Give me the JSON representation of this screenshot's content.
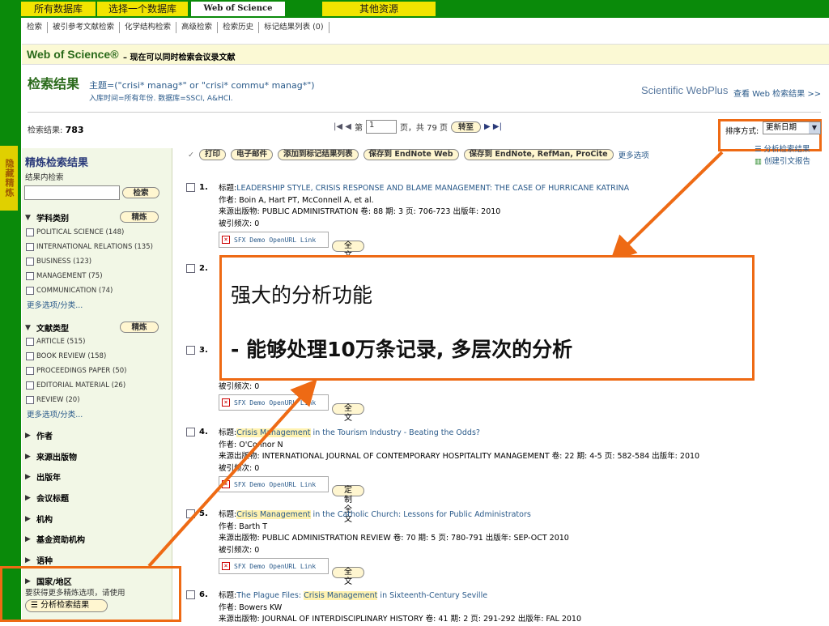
{
  "top_tabs": [
    {
      "label": "所有数据库"
    },
    {
      "label": "选择一个数据库"
    },
    {
      "label": "Web of Science"
    },
    {
      "label": "其他资源"
    }
  ],
  "sub_nav": [
    "检索",
    "被引参考文献检索",
    "化学结构检索",
    "高级检索",
    "检索历史",
    "标记结果列表 (0)"
  ],
  "side_tab": "隐藏精炼",
  "title_bar": {
    "brand": "Web of Science®",
    "subtitle": "– 现在可以同时检索会议录文献"
  },
  "search_results": {
    "heading": "检索结果",
    "query": "主题=(\"crisi* manag*\" or \"crisi* commu* manag*\")",
    "sub": "入库时间=所有年份. 数据库=SSCI, A&HCI.",
    "webplus_logo": "Scientific WebPlus",
    "webplus_link": "查看 Web 检索结果 >>",
    "count_label": "检索结果:",
    "count": "783"
  },
  "pager": {
    "first_prev": "|◀ ◀",
    "page_label": "第",
    "page_value": "1",
    "of_label": "页，共 79 页",
    "go_button": "转至",
    "next_last": "▶ ▶|"
  },
  "sort": {
    "label": "排序方式:",
    "value": "更新日期"
  },
  "right_links": {
    "analyze": "分析检索结果",
    "citation_report": "创建引文报告"
  },
  "refine": {
    "title": "精炼检索结果",
    "within_label": "结果内检索",
    "search_button": "检索",
    "subject": {
      "label": "学科类别",
      "button": "精炼",
      "items": [
        "POLITICAL SCIENCE (148)",
        "INTERNATIONAL RELATIONS (135)",
        "BUSINESS (123)",
        "MANAGEMENT (75)",
        "COMMUNICATION (74)"
      ],
      "more": "更多选项/分类..."
    },
    "doctype": {
      "label": "文献类型",
      "button": "精炼",
      "items": [
        "ARTICLE (515)",
        "BOOK REVIEW (158)",
        "PROCEEDINGS PAPER (50)",
        "EDITORIAL MATERIAL (26)",
        "REVIEW (20)"
      ],
      "more": "更多选项/分类..."
    },
    "collapsed": [
      "作者",
      "来源出版物",
      "出版年",
      "会议标题",
      "机构",
      "基金资助机构",
      "语种",
      "国家/地区"
    ],
    "note": "要获得更多精炼选项，请使用",
    "analyze_button": "分析检索结果"
  },
  "toolbar": {
    "buttons": [
      "打印",
      "电子邮件",
      "添加到标记结果列表"
    ],
    "save_endnote_web": "保存到 EndNote Web",
    "save_endnote": "保存到 EndNote, RefMan, ProCite",
    "more": "更多选项"
  },
  "records": [
    {
      "num": "1.",
      "title_label": "标题:",
      "title": "LEADERSHIP STYLE, CRISIS RESPONSE AND BLAME MANAGEMENT: THE CASE OF HURRICANE KATRINA",
      "author": "作者: Boin A, Hart PT, McConnell A, et al.",
      "source": "来源出版物: PUBLIC ADMINISTRATION  卷: 88  期: 3  页: 706-723  出版年: 2010",
      "cited": "被引频次: 0",
      "sfx": "SFX Demo OpenURL Link",
      "fulltext": "全文"
    },
    {
      "num": "2."
    },
    {
      "num": "3.",
      "cited": "被引频次: 0",
      "sfx": "SFX Demo OpenURL Link",
      "fulltext": "全文"
    },
    {
      "num": "4.",
      "title_label": "标题:",
      "title_hl": "Crisis Management",
      "title": " in the Tourism Industry - Beating the Odds?",
      "author": "作者: O'Connor N",
      "source": "来源出版物: INTERNATIONAL JOURNAL OF CONTEMPORARY HOSPITALITY MANAGEMENT  卷: 22  期: 4-5  页: 582-584  出版年: 2010",
      "cited": "被引频次: 0",
      "sfx": "SFX Demo OpenURL Link",
      "fulltext": "定制全文"
    },
    {
      "num": "5.",
      "title_label": "标题:",
      "title_hl": "Crisis Management",
      "title": " in the Catholic Church: Lessons for Public Administrators",
      "author": "作者: Barth T",
      "source": "来源出版物: PUBLIC ADMINISTRATION REVIEW  卷: 70  期: 5  页: 780-791  出版年: SEP-OCT 2010",
      "cited": "被引频次: 0",
      "sfx": "SFX Demo OpenURL Link",
      "fulltext": "全文"
    },
    {
      "num": "6.",
      "title_label": "标题:",
      "title_pre": "The Plague Files: ",
      "title_hl": "Crisis Management",
      "title": " in Sixteenth-Century Seville",
      "author": "作者: Bowers KW",
      "source": "来源出版物: JOURNAL OF INTERDISCIPLINARY HISTORY  卷: 41  期: 2  页: 291-292  出版年: FAL 2010"
    }
  ],
  "callout": {
    "line1": "强大的分析功能",
    "line2": "- 能够处理10万条记录, 多层次的分析"
  },
  "colors": {
    "green": "#0a8a0a",
    "yellow": "#f2e400",
    "orange": "#ee6a14",
    "link": "#2a5a8a"
  }
}
